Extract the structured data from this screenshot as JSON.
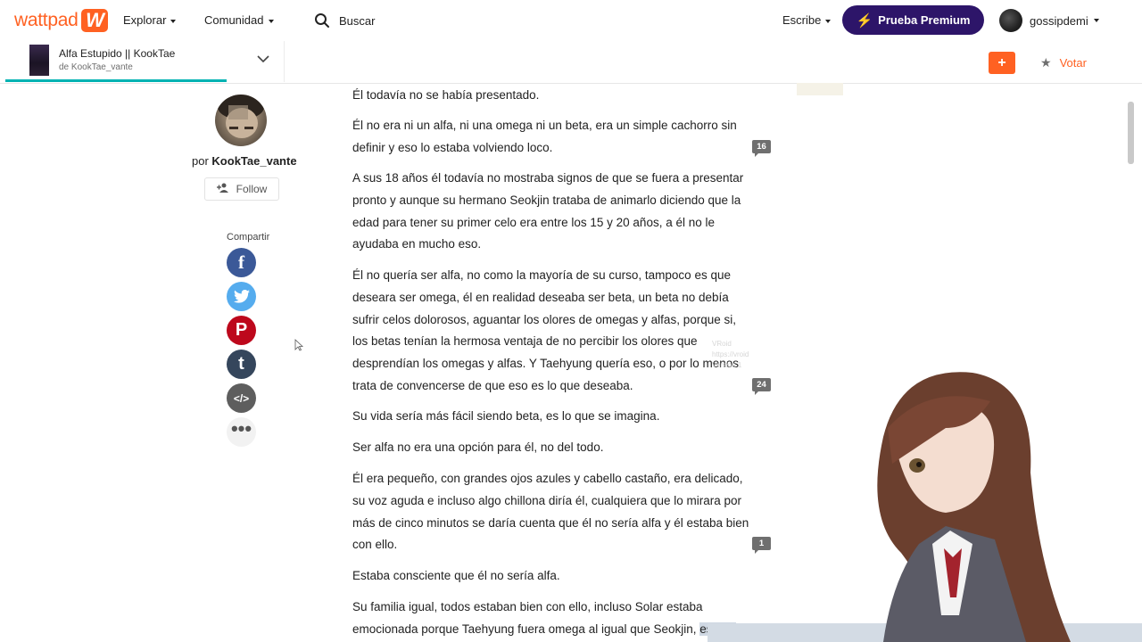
{
  "nav": {
    "logo_text": "wattpad",
    "logo_mark": "W",
    "explore": "Explorar",
    "community": "Comunidad",
    "search_placeholder": "Buscar",
    "write": "Escribe",
    "premium": "Prueba Premium",
    "username": "gossipdemi"
  },
  "story": {
    "title": "Alfa Estupido || KookTae",
    "author_line": "de KookTae_vante",
    "add_label": "+",
    "vote_label": "Votar",
    "progress_fraction": 0.2
  },
  "author": {
    "by": "por",
    "name": "KookTae_vante",
    "follow": "Follow"
  },
  "share": {
    "label": "Compartir",
    "icons": [
      "facebook-icon",
      "twitter-icon",
      "pinterest-icon",
      "tumblr-icon",
      "embed-icon",
      "more-icon"
    ]
  },
  "paragraphs": [
    "Él todavía no se había presentado.",
    "Él no era ni un alfa, ni una omega ni un beta, era un simple cachorro sin definir y eso lo estaba volviendo loco.",
    "A sus 18 años él todavía no mostraba signos de que se fuera a presentar pronto y aunque su hermano Seokjin trataba de animarlo diciendo que la edad para tener su primer celo era entre los 15 y 20 años, a él no le ayudaba en mucho eso.",
    "Él no quería ser alfa, no como la mayoría de su curso, tampoco es que deseara ser omega, él en realidad deseaba ser beta, un beta no debía sufrir celos dolorosos, aguantar los olores de omegas y alfas, porque si, los betas tenían la hermosa ventaja de no percibir los olores que desprendían los omegas y alfas. Y Taehyung quería eso, o por lo menos trata de convencerse de que eso es lo que deseaba.",
    "Su vida sería más fácil siendo beta, es lo que se imagina.",
    "Ser alfa no era una opción para él, no del todo.",
    "Él era pequeño, con grandes ojos azules y cabello castaño, era delicado, su voz aguda e incluso algo chillona diría él, cualquiera que lo mirara por más de cinco minutos se daría cuenta que él no sería alfa y él estaba bien con ello.",
    "Estaba consciente que él no sería alfa.",
    "Su familia igual, todos estaban bien con ello, incluso Solar estaba emocionada porque Taehyung fuera omega al igual que Seokjin,",
    "estaba"
  ],
  "comments": [
    "16",
    "24",
    "1"
  ],
  "colors": {
    "brand": "#ff6122",
    "premium": "#2d1569",
    "progress": "#00b2b2",
    "facebook": "#3b5998",
    "twitter": "#55acee",
    "pinterest": "#bd081c",
    "tumblr": "#35465c"
  }
}
